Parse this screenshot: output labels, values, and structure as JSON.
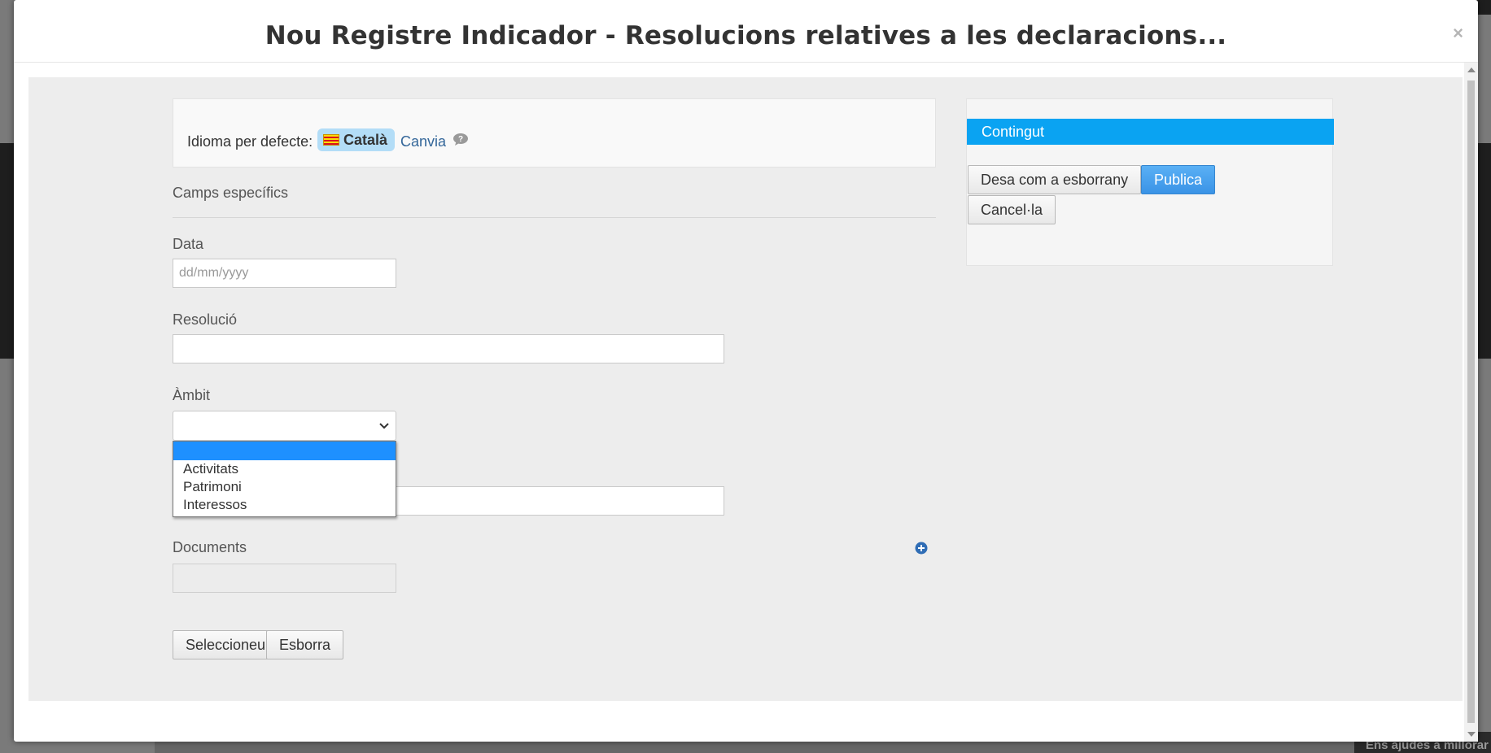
{
  "modal": {
    "title": "Nou Registre Indicador - Resolucions relatives a les declaracions...",
    "close_label": "×"
  },
  "language": {
    "label": "Idioma per defecte:",
    "current": "Català",
    "change_label": "Canvia"
  },
  "section": {
    "title": "Camps específics"
  },
  "fields": {
    "data": {
      "label": "Data",
      "placeholder": "dd/mm/yyyy",
      "value": ""
    },
    "resolucio": {
      "label": "Resolució",
      "value": ""
    },
    "ambit": {
      "label": "Àmbit",
      "selected": "",
      "options": [
        "",
        "Activitats",
        "Patrimoni",
        "Interessos"
      ]
    },
    "documents": {
      "label": "Documents",
      "value": ""
    }
  },
  "documents_buttons": {
    "select": "Seleccioneu",
    "delete": "Esborra"
  },
  "panel": {
    "title": "Contingut",
    "save_draft": "Desa com a esborrany",
    "publish": "Publica",
    "cancel": "Cancel·la"
  },
  "background": {
    "corner_text": "Ens ajudes a millorar"
  },
  "colors": {
    "accent": "#0aa3f2",
    "primary_button": "#3a93e6",
    "selected_option": "#1e90ff"
  }
}
